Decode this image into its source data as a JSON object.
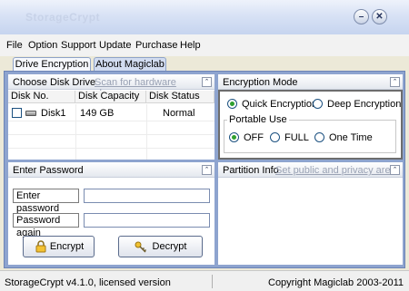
{
  "window": {
    "title": "StorageCrypt"
  },
  "menu": [
    "File",
    "Option",
    "Support",
    "Update",
    "Purchase",
    "Help"
  ],
  "tabs": [
    {
      "label": "Drive Encryption",
      "active": true
    },
    {
      "label": "About Magiclab",
      "active": false
    }
  ],
  "disk_panel": {
    "title": "Choose Disk Drive",
    "link": "Scan for hardware changes",
    "columns": [
      "Disk No.",
      "Disk Capacity",
      "Disk Status"
    ],
    "rows": [
      {
        "disk": "Disk1",
        "capacity": "149 GB",
        "status": "Normal",
        "checked": false
      }
    ]
  },
  "encryption_panel": {
    "title": "Encryption Mode",
    "modes": [
      {
        "label": "Quick Encryption",
        "selected": true
      },
      {
        "label": "Deep Encryption",
        "selected": false
      }
    ],
    "portable_label": "Portable Use",
    "portable_options": [
      {
        "label": "OFF",
        "selected": true
      },
      {
        "label": "FULL",
        "selected": false
      },
      {
        "label": "One Time",
        "selected": false
      }
    ]
  },
  "password_panel": {
    "title": "Enter Password",
    "enter_label": "Enter password",
    "enter_value": "",
    "again_label": "Password again",
    "again_value": "",
    "encrypt_label": "Encrypt",
    "decrypt_label": "Decrypt"
  },
  "partition_panel": {
    "title": "Partition Info",
    "link": "Set public and privacy area"
  },
  "status": {
    "left": "StorageCrypt v4.1.0, licensed version",
    "right": "Copyright Magiclab 2003-2011"
  },
  "colors": {
    "frame_blue": "#8ea4cf",
    "radio_selected": "#2fa02f",
    "link_gray": "#9aa2b4"
  }
}
